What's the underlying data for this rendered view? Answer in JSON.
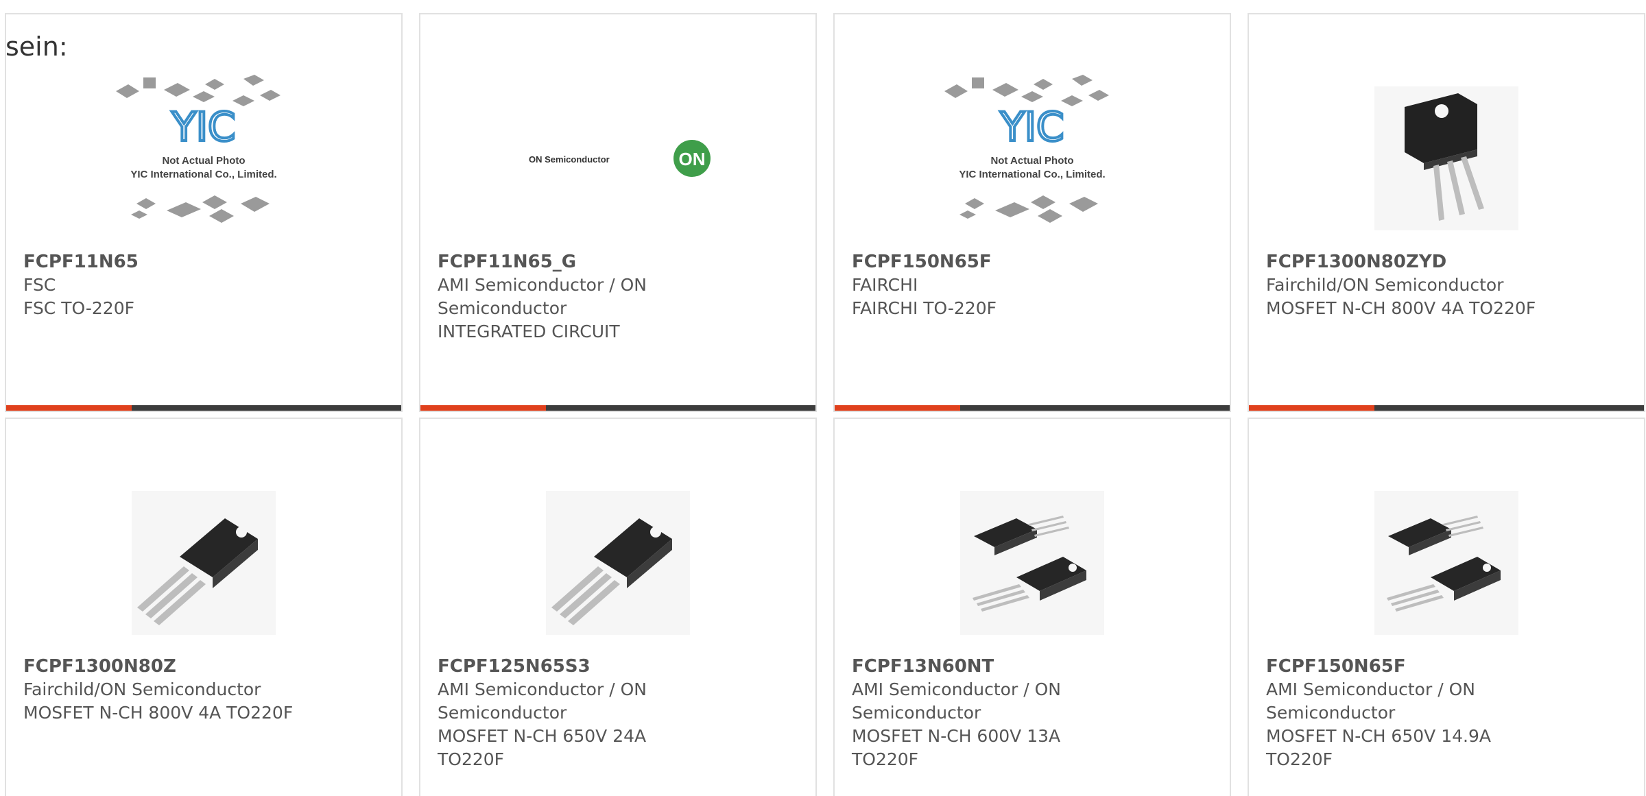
{
  "intro_text": "sein:",
  "colors": {
    "card_border": "#e1e1e1",
    "accent": "#e0401c",
    "bar": "#3c3c3c",
    "text": "#555555"
  },
  "placeholder_image": {
    "line1": "Not Actual Photo",
    "line2": "YIC International Co., Limited.",
    "logo": "YIC"
  },
  "on_logo": {
    "text": "ON Semiconductor",
    "badge": "ON"
  },
  "products": [
    {
      "part_number": "FCPF11N65",
      "manufacturer": "FSC",
      "description": "FSC TO-220F",
      "image": "not-actual-photo-placeholder"
    },
    {
      "part_number": "FCPF11N65_G",
      "manufacturer": "AMI Semiconductor / ON Semiconductor",
      "description": "INTEGRATED CIRCUIT",
      "image": "on-semiconductor-logo"
    },
    {
      "part_number": "FCPF150N65F",
      "manufacturer": "FAIRCHI",
      "description": "FAIRCHI TO-220F",
      "image": "not-actual-photo-placeholder"
    },
    {
      "part_number": "FCPF1300N80ZYD",
      "manufacturer": "Fairchild/ON Semiconductor",
      "description": "MOSFET N-CH 800V 4A TO220F",
      "image": "to220f-front-photo"
    },
    {
      "part_number": "FCPF1300N80Z",
      "manufacturer": "Fairchild/ON Semiconductor",
      "description": "MOSFET N-CH 800V 4A TO220F",
      "image": "to220f-angled-photo"
    },
    {
      "part_number": "FCPF125N65S3",
      "manufacturer": "AMI Semiconductor / ON Semiconductor",
      "description": "MOSFET N-CH 650V 24A TO220F",
      "image": "to220f-angled-photo"
    },
    {
      "part_number": "FCPF13N60NT",
      "manufacturer": "AMI Semiconductor / ON Semiconductor",
      "description": "MOSFET N-CH 600V 13A TO220F",
      "image": "to220f-pair-photo"
    },
    {
      "part_number": "FCPF150N65F",
      "manufacturer": "AMI Semiconductor / ON Semiconductor",
      "description": "MOSFET N-CH 650V 14.9A TO220F",
      "image": "to220f-pair-photo"
    }
  ]
}
